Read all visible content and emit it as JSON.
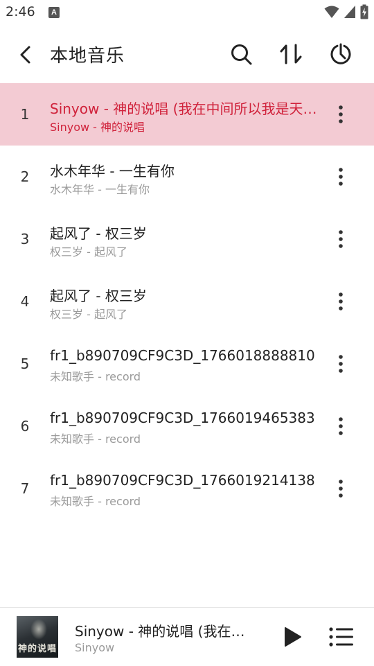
{
  "status_bar": {
    "time": "2:46",
    "notification_badge": "A"
  },
  "app_bar": {
    "title": "本地音乐",
    "icons": [
      "back-icon",
      "search-icon",
      "sort-icon",
      "timer-icon"
    ]
  },
  "songs": [
    {
      "index": "1",
      "title": "Sinyow - 神的说唱 (我在中间所以我是天神)",
      "subtitle": "Sinyow - 神的说唱",
      "playing": true
    },
    {
      "index": "2",
      "title": "水木年华 - 一生有你",
      "subtitle": "水木年华 - 一生有你",
      "playing": false
    },
    {
      "index": "3",
      "title": "起风了 - 权三岁",
      "subtitle": "权三岁 - 起风了",
      "playing": false
    },
    {
      "index": "4",
      "title": "起风了 - 权三岁",
      "subtitle": "权三岁 - 起风了",
      "playing": false
    },
    {
      "index": "5",
      "title": "fr1_b890709CF9C3D_1766018888810",
      "subtitle": "未知歌手 - record",
      "playing": false
    },
    {
      "index": "6",
      "title": "fr1_b890709CF9C3D_1766019465383",
      "subtitle": "未知歌手 - record",
      "playing": false
    },
    {
      "index": "7",
      "title": "fr1_b890709CF9C3D_1766019214138",
      "subtitle": "未知歌手 - record",
      "playing": false
    }
  ],
  "player": {
    "title": "Sinyow - 神的说唱 (我在中间所以我是天神)",
    "artist": "Sinyow",
    "cover_text": "神的说唱"
  },
  "colors": {
    "accent": "#d0223b",
    "active_row_bg": "#f3cbd3",
    "secondary_text": "#9a9a9a"
  }
}
